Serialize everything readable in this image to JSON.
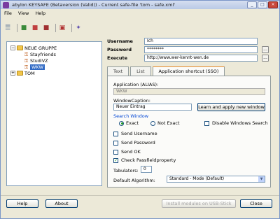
{
  "window": {
    "title": "abylon KEYSAFE (Betaversion (Valid)) - Current safe-file 'tom - safe.xml'",
    "btn_min": "_",
    "btn_max": "□",
    "btn_close": "×"
  },
  "menu": {
    "file": "File",
    "view": "View",
    "help": "Help"
  },
  "tree": {
    "group1": {
      "label": "NEUE GRUPPE",
      "expander": "−"
    },
    "items": [
      "Stayfriends",
      "StudiVZ",
      "WKW"
    ],
    "group2": {
      "label": "TOM",
      "expander": "+"
    }
  },
  "entry": {
    "username_label": "Username",
    "username_value": "Ich",
    "password_label": "Password",
    "password_value": "********",
    "execute_label": "Execute",
    "execute_value": "http://www.wer-kennt-wen.de",
    "dots": "..."
  },
  "tabs": [
    "Text",
    "List",
    "Application shortcut (SSO)"
  ],
  "sso": {
    "app_alias_label": "Application (ALIAS):",
    "app_alias_value": "WKW",
    "window_caption_label": "WindowCaption:",
    "window_caption_value": "Neuer Eintrag",
    "learn_button": "Learn and apply new window",
    "search_window_label": "Search Window",
    "radio_exact": "Exact",
    "radio_not_exact": "Not Exact",
    "disable_windows_search": "Disable Windows Search",
    "send_username": "Send Username",
    "send_password": "Send Password",
    "send_ok": "Send OK",
    "check_passfield": "Check Passfieldproperty",
    "check_mark": "✓",
    "tabulators_label": "Tabulators:",
    "tabulators_value": "0",
    "default_algorithm_label": "Default Algorithm:",
    "default_algorithm_value": "Standard - Mode (Default)",
    "select_arrow": "▼"
  },
  "footer": {
    "help": "Help",
    "about": "About",
    "install_usb": "Install modules on USB-Stick",
    "close": "Close"
  }
}
